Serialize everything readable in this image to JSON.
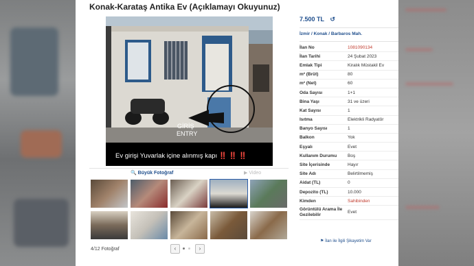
{
  "listing": {
    "title": "Konak-Karataş Antika Ev (Açıklamayı Okuyunuz)",
    "price": "7.500 TL",
    "location": "İzmir  /  Konak  /  Barbaros Mah.",
    "photo_caption": "Ev girişi Yuvarlak içine alınmış kapı ‼️ ‼️ ‼️",
    "photo_arrow_label_tr": "GİRİŞ",
    "photo_arrow_label_en": "ENTRY"
  },
  "gallery": {
    "big_photo_label": "Büyük Fotoğraf",
    "video_label": "Video",
    "counter": "4/12 Fotoğraf",
    "prev": "‹",
    "next": "›"
  },
  "details": [
    {
      "key": "İlan No",
      "value": "1081090134",
      "red": true
    },
    {
      "key": "İlan Tarihi",
      "value": "24 Şubat 2023"
    },
    {
      "key": "Emlak Tipi",
      "value": "Kiralık Müstakil Ev"
    },
    {
      "key": "m² (Brüt)",
      "value": "80"
    },
    {
      "key": "m² (Net)",
      "value": "60"
    },
    {
      "key": "Oda Sayısı",
      "value": "1+1"
    },
    {
      "key": "Bina Yaşı",
      "value": "31 ve üzeri"
    },
    {
      "key": "Kat Sayısı",
      "value": "1"
    },
    {
      "key": "Isıtma",
      "value": "Elektrikli Radyatör"
    },
    {
      "key": "Banyo Sayısı",
      "value": "1"
    },
    {
      "key": "Balkon",
      "value": "Yok"
    },
    {
      "key": "Eşyalı",
      "value": "Evet"
    },
    {
      "key": "Kullanım Durumu",
      "value": "Boş"
    },
    {
      "key": "Site İçerisinde",
      "value": "Hayır"
    },
    {
      "key": "Site Adı",
      "value": "Belirtilmemiş"
    },
    {
      "key": "Aidat (TL)",
      "value": "0"
    },
    {
      "key": "Depozito (TL)",
      "value": "10.000"
    },
    {
      "key": "Kimden",
      "value": "Sahibinden",
      "red": true
    },
    {
      "key": "Görüntülü Arama İle Gezilebilir",
      "value": "Evet",
      "tall": true
    }
  ],
  "complaint_label": "İlan ile İlgili Şikayetim Var",
  "icons": {
    "price_history": "history-icon",
    "search": "search-icon",
    "video": "video-icon",
    "complaint": "flag-icon"
  },
  "colors": {
    "link": "#1f4e8c",
    "highlight": "#c0392b"
  }
}
